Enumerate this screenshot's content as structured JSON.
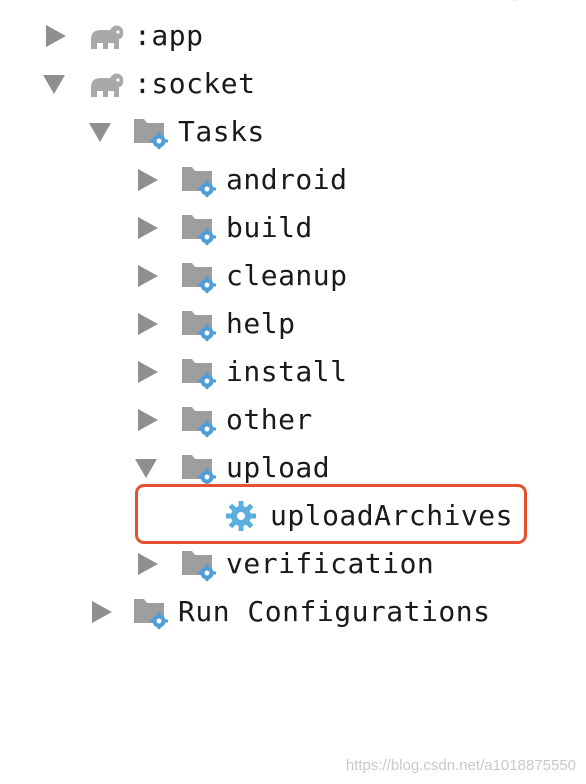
{
  "tree": {
    "app": {
      "label": ":app",
      "expanded": false,
      "icon": "gradle-elephant-icon"
    },
    "socket": {
      "label": ":socket",
      "expanded": true,
      "icon": "gradle-elephant-icon"
    },
    "tasks": {
      "label": "Tasks",
      "expanded": true,
      "icon": "folder-gear-icon"
    },
    "groups": [
      {
        "label": "android",
        "expanded": false
      },
      {
        "label": "build",
        "expanded": false
      },
      {
        "label": "cleanup",
        "expanded": false
      },
      {
        "label": "help",
        "expanded": false
      },
      {
        "label": "install",
        "expanded": false
      },
      {
        "label": "other",
        "expanded": false
      },
      {
        "label": "upload",
        "expanded": true
      },
      {
        "label": "verification",
        "expanded": false
      }
    ],
    "upload_task": {
      "label": "uploadArchives",
      "icon": "gear-icon",
      "highlighted": true
    },
    "run_configurations": {
      "label": "Run Configurations",
      "expanded": false,
      "icon": "folder-gear-icon"
    }
  },
  "watermark": "https://blog.csdn.net/a1018875550",
  "colors": {
    "arrow": "#8f8f8f",
    "elephant": "#a9a9a9",
    "folder": "#9e9e9e",
    "gear": "#4a9fd8",
    "highlight_border": "#e5502e",
    "text": "#1a1a1a",
    "watermark": "#c9c9c9"
  }
}
